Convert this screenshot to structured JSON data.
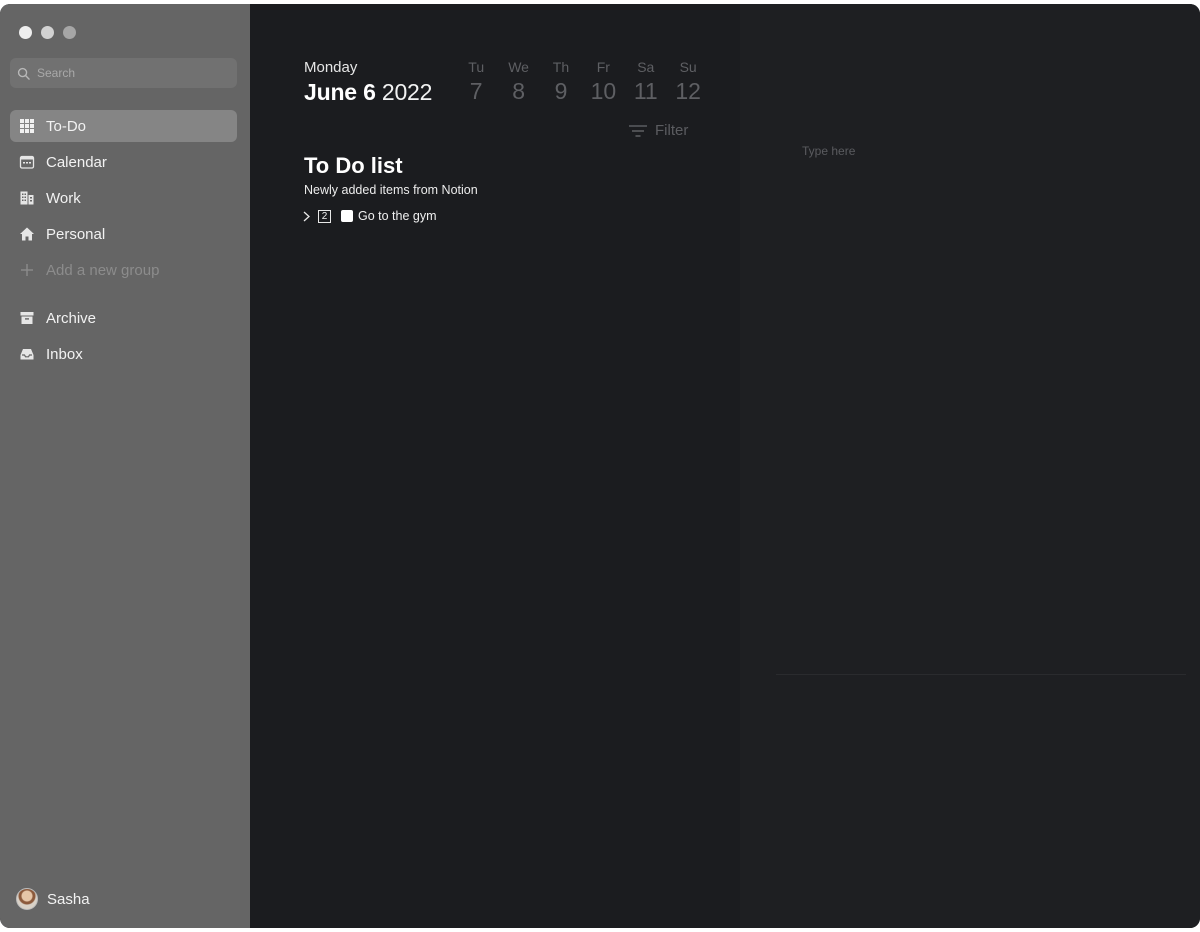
{
  "window": {
    "traffic_lights": [
      "close",
      "minimize",
      "zoom"
    ]
  },
  "sidebar": {
    "search": {
      "placeholder": "Search",
      "value": ""
    },
    "items": [
      {
        "label": "To-Do",
        "icon": "grid-icon",
        "active": true
      },
      {
        "label": "Calendar",
        "icon": "calendar-icon"
      },
      {
        "label": "Work",
        "icon": "building-icon"
      },
      {
        "label": "Personal",
        "icon": "house-icon"
      },
      {
        "label": "Add a new group",
        "icon": "plus-icon"
      },
      {
        "label": "Archive",
        "icon": "archive-box-icon"
      },
      {
        "label": "Inbox",
        "icon": "inbox-tray-icon"
      }
    ],
    "user": {
      "name": "Sasha"
    }
  },
  "header": {
    "weekday": "Monday",
    "date": "June 6",
    "year": "2022",
    "week": [
      {
        "abbr": "Tu",
        "num": "7"
      },
      {
        "abbr": "We",
        "num": "8"
      },
      {
        "abbr": "Th",
        "num": "9"
      },
      {
        "abbr": "Fr",
        "num": "10"
      },
      {
        "abbr": "Sa",
        "num": "11"
      },
      {
        "abbr": "Su",
        "num": "12"
      }
    ],
    "filter_label": "Filter"
  },
  "list": {
    "title": "To Do list",
    "subtitle": "Newly added items from Notion",
    "tasks": [
      {
        "count": "2",
        "label": "Go to the gym",
        "checked": false
      }
    ]
  },
  "detail": {
    "placeholder": "Type here"
  },
  "colors": {
    "sidebar_bg": "#656565",
    "main_bg": "#1b1c1f",
    "detail_bg": "#1e1f22",
    "active_item_bg": "#858585"
  }
}
